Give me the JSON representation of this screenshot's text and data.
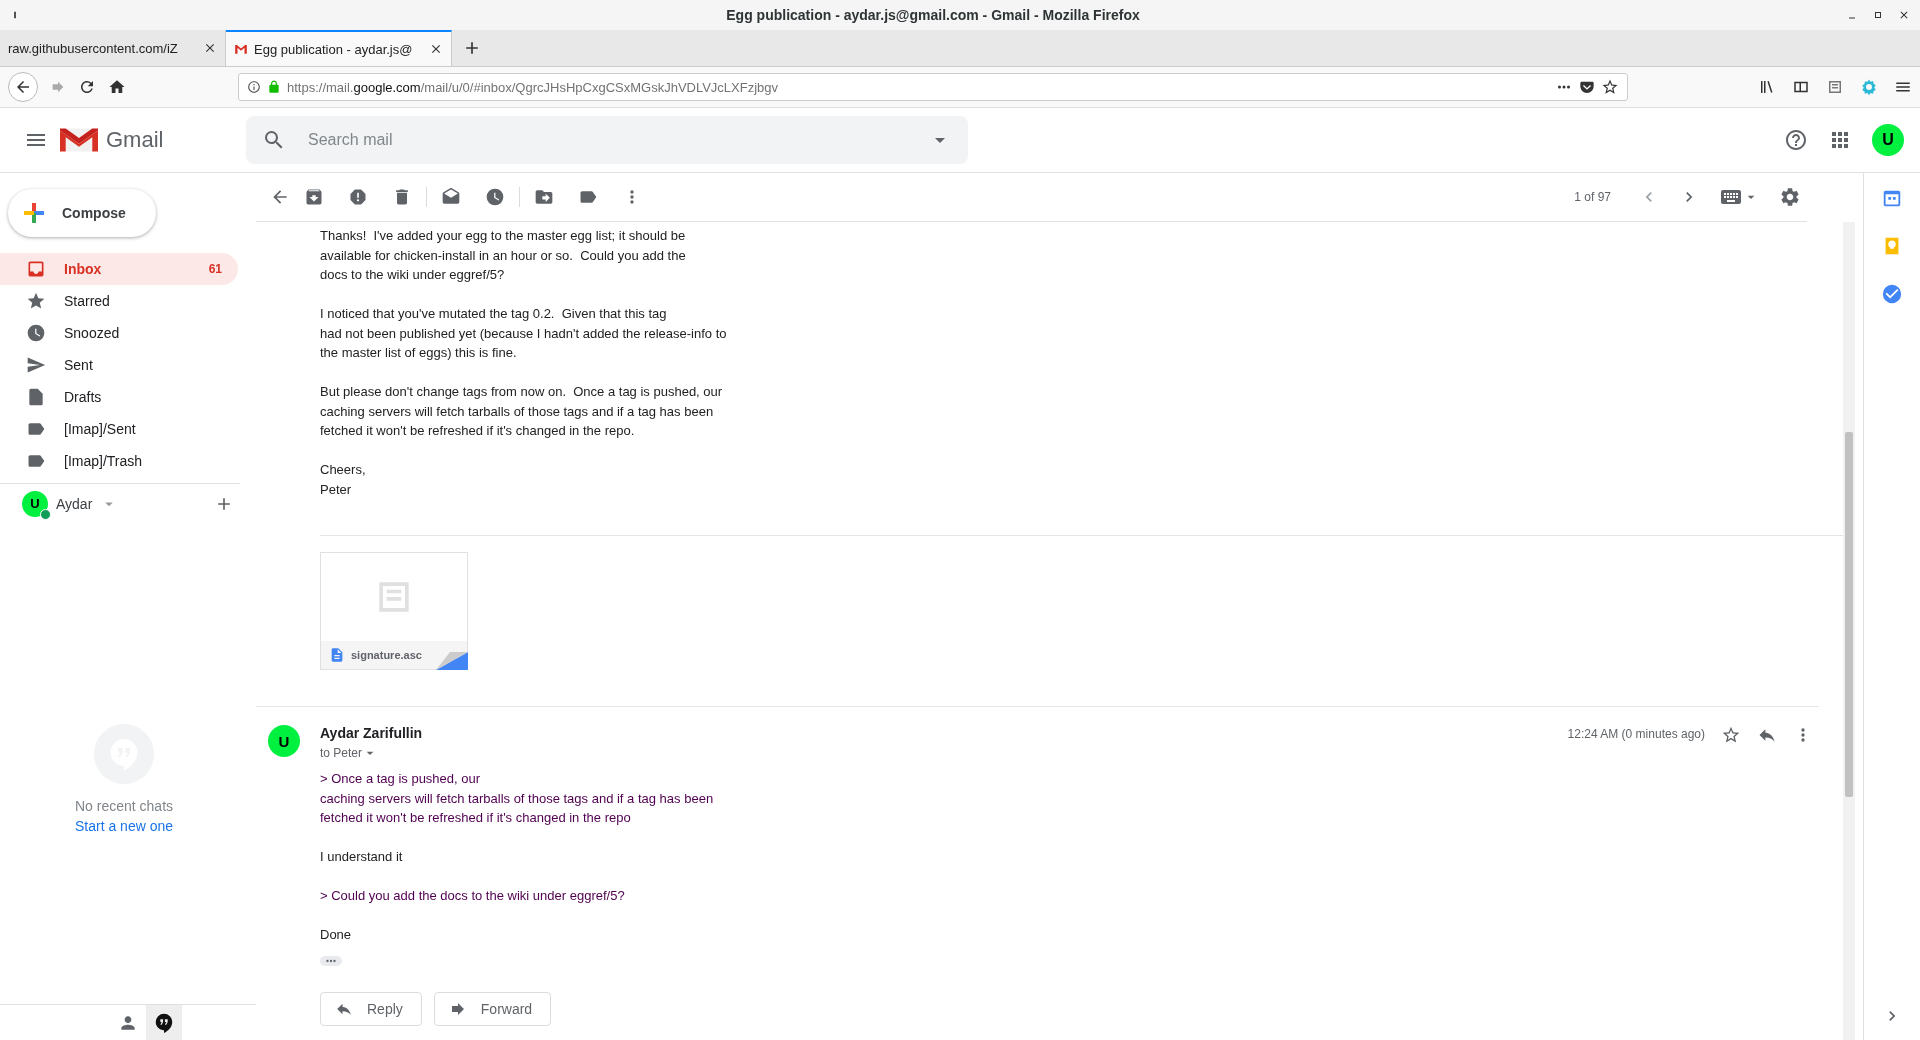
{
  "window": {
    "title": "Egg publication - aydar.js@gmail.com - Gmail - Mozilla Firefox"
  },
  "browser_tabs": [
    {
      "label": "raw.githubusercontent.com/iZ",
      "selected": false,
      "kind": "page"
    },
    {
      "label": "Egg publication - aydar.js@",
      "selected": true,
      "kind": "mail"
    }
  ],
  "address_bar": {
    "scheme": "https://mail.",
    "domain": "google.com",
    "path": "/mail/u/0/#inbox/QgrcJHsHpCxgCSxMGskJhVDLVJcLXFzjbgv"
  },
  "gmail": {
    "brand": "Gmail",
    "search": {
      "placeholder": "Search mail"
    },
    "avatar_letter": "U"
  },
  "compose": "Compose",
  "folders": [
    {
      "label": "Inbox",
      "kind": "inbox",
      "count": "61",
      "selected": true
    },
    {
      "label": "Starred",
      "kind": "star",
      "selected": false
    },
    {
      "label": "Snoozed",
      "kind": "clock",
      "selected": false
    },
    {
      "label": "Sent",
      "kind": "send",
      "selected": false
    },
    {
      "label": "Drafts",
      "kind": "draft",
      "selected": false
    },
    {
      "label": "[Imap]/Sent",
      "kind": "label",
      "selected": false
    },
    {
      "label": "[Imap]/Trash",
      "kind": "label",
      "selected": false
    }
  ],
  "account": {
    "name": "Aydar",
    "avatar_letter": "U"
  },
  "hangouts": {
    "empty_text": "No recent chats",
    "link": "Start a new one"
  },
  "chat_tabs": [
    {
      "kind": "contacts",
      "selected": false
    },
    {
      "kind": "hangouts",
      "selected": true
    }
  ],
  "toolbar": {
    "pager": "1 of 97"
  },
  "messages": [
    {
      "paragraphs": [
        [
          "Thanks!  I've added your egg to the master egg list; it should be",
          "available for chicken-install in an hour or so.  Could you add the",
          "docs to the wiki under eggref/5?"
        ],
        [
          "I noticed that you've mutated the tag 0.2.  Given that this tag",
          "had not been published yet (because I hadn't added the release-info to",
          "the master list of eggs) this is fine."
        ],
        [
          "But please don't change tags from now on.  Once a tag is pushed, our",
          "caching servers will fetch tarballs of those tags and if a tag has been",
          "fetched it won't be refreshed if it's changed in the repo."
        ],
        [
          "Cheers,",
          "Peter"
        ]
      ],
      "attachment": {
        "filename": "signature.asc"
      }
    },
    {
      "sender": "Aydar Zarifullin",
      "recipient": "to Peter",
      "time": "12:24 AM (0 minutes ago)",
      "avatar_letter": "U",
      "blocks": [
        {
          "kind": "quote",
          "lines": [
            "> Once a tag is pushed, our",
            "caching servers will fetch tarballs of those tags and if a tag has been",
            "fetched it won't be refreshed if it's changed in the repo"
          ]
        },
        {
          "kind": "text",
          "lines": [
            "I understand it"
          ]
        },
        {
          "kind": "quote",
          "lines": [
            "> Could you add the docs to the wiki under eggref/5?"
          ]
        },
        {
          "kind": "text",
          "lines": [
            "Done"
          ]
        }
      ]
    }
  ],
  "actions": [
    {
      "label": "Reply",
      "kind": "reply"
    },
    {
      "label": "Forward",
      "kind": "forward"
    }
  ]
}
